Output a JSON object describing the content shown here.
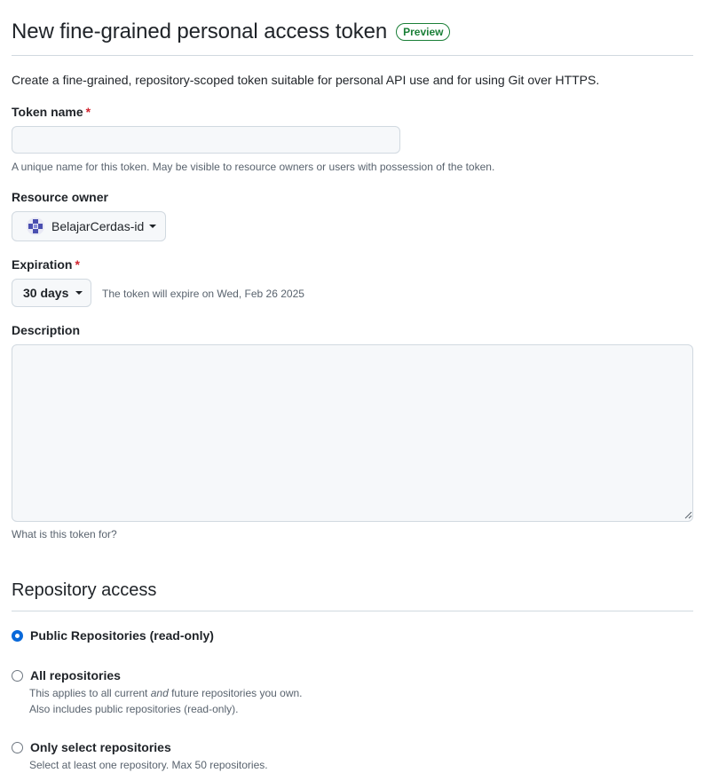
{
  "header": {
    "title": "New fine-grained personal access token",
    "badge": "Preview",
    "intro": "Create a fine-grained, repository-scoped token suitable for personal API use and for using Git over HTTPS."
  },
  "token_name": {
    "label": "Token name",
    "required_mark": "*",
    "value": "",
    "placeholder": "",
    "hint": "A unique name for this token. May be visible to resource owners or users with possession of the token."
  },
  "resource_owner": {
    "label": "Resource owner",
    "selected": "BelajarCerdas-id"
  },
  "expiration": {
    "label": "Expiration",
    "required_mark": "*",
    "selected": "30 days",
    "note": "The token will expire on Wed, Feb 26 2025"
  },
  "description": {
    "label": "Description",
    "value": "",
    "hint": "What is this token for?"
  },
  "repository_access": {
    "title": "Repository access",
    "options": [
      {
        "label": "Public Repositories (read-only)",
        "checked": true
      },
      {
        "label": "All repositories",
        "checked": false,
        "help_pre": "This applies to all current ",
        "help_em": "and",
        "help_post": " future repositories you own.",
        "help_line2": "Also includes public repositories (read-only)."
      },
      {
        "label": "Only select repositories",
        "checked": false,
        "help_line1": "Select at least one repository. Max 50 repositories."
      }
    ]
  },
  "colors": {
    "accent": "#0969da",
    "success": "#1a7f37",
    "danger": "#d1242f",
    "input_bg": "#f6f8fa",
    "border": "#d1d9e0"
  }
}
